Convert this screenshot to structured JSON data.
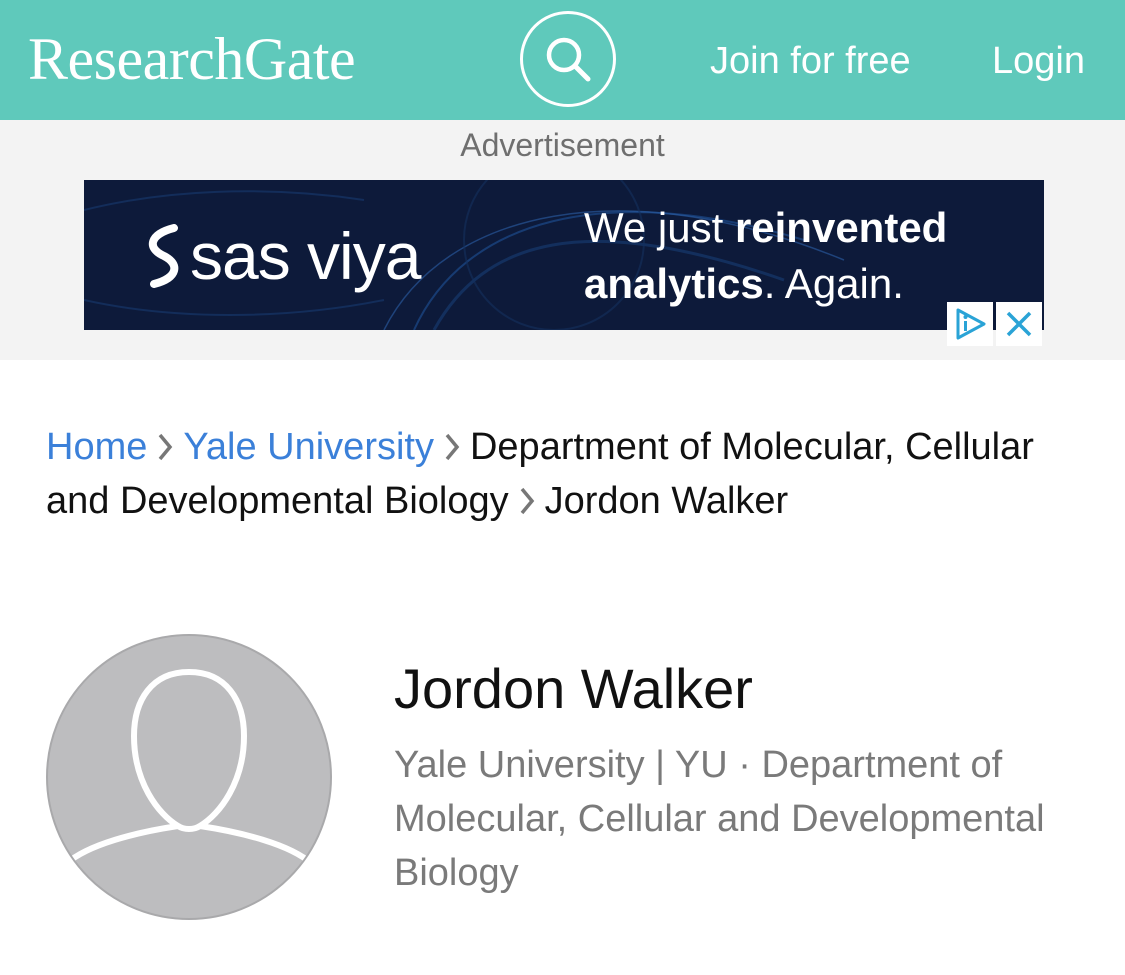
{
  "header": {
    "logo": "ResearchGate",
    "join_label": "Join for free",
    "login_label": "Login",
    "search_icon": "search-icon",
    "color": "#5fc9bb"
  },
  "ad": {
    "label": "Advertisement",
    "brand": "sas viya",
    "tagline_light_1": "We just ",
    "tagline_bold_1": "reinvented",
    "tagline_bold_2": "analytics",
    "tagline_light_2": ". Again.",
    "adchoices_icon": "adchoices-icon",
    "close_icon": "close-icon"
  },
  "breadcrumb": {
    "home": "Home",
    "university": "Yale University",
    "department": "Department of Molecular, Cellular and Developmental Biology",
    "person": "Jordon Walker",
    "link_color": "#3b80d9"
  },
  "profile": {
    "name": "Jordon Walker",
    "affiliation": "Yale University | YU · Department of Molecular, Cellular and Developmental Biology",
    "avatar_icon": "person-placeholder-icon"
  }
}
